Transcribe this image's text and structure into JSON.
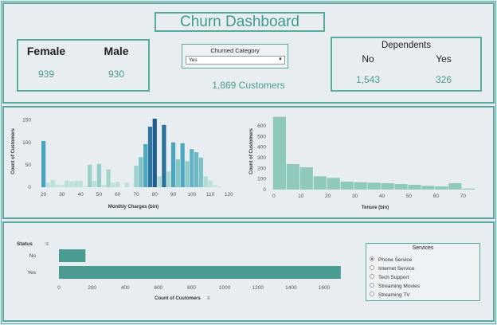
{
  "header": {
    "title": "Churn Dashboard"
  },
  "gender": {
    "female_label": "Female",
    "male_label": "Male",
    "female_value": "939",
    "male_value": "930"
  },
  "filter": {
    "title": "Churned Category",
    "selected": "Yes"
  },
  "customers_text": "1,869 Customers",
  "dependents": {
    "title": "Dependents",
    "no_label": "No",
    "yes_label": "Yes",
    "no_value": "1,543",
    "yes_value": "326"
  },
  "services": {
    "title": "Services",
    "items": [
      "Phone Service",
      "Internet Service",
      "Tech Support",
      "Streaming Movies",
      "Streaming TV"
    ],
    "selected": "Phone Service"
  },
  "chart_data": [
    {
      "type": "bar",
      "xlabel": "Monthly Charges (bin)",
      "ylabel": "Count of Customers",
      "xlim": [
        15,
        122
      ],
      "ylim": [
        0,
        160
      ],
      "xticks": [
        20,
        30,
        40,
        50,
        60,
        70,
        80,
        90,
        100,
        110,
        120
      ],
      "yticks": [
        0,
        50,
        100,
        150
      ],
      "bin_width": 2.5,
      "x": [
        20,
        22.5,
        25,
        27.5,
        30,
        32.5,
        35,
        37.5,
        40,
        42.5,
        45,
        47.5,
        50,
        52.5,
        55,
        57.5,
        60,
        62.5,
        65,
        67.5,
        70,
        72.5,
        75,
        77.5,
        80,
        82.5,
        85,
        87.5,
        90,
        92.5,
        95,
        97.5,
        100,
        102.5,
        105,
        107.5,
        110,
        112.5,
        115,
        117.5
      ],
      "values": [
        103,
        10,
        16,
        6,
        5,
        15,
        13,
        14,
        14,
        2,
        50,
        14,
        52,
        5,
        40,
        10,
        12,
        0,
        10,
        0,
        48,
        67,
        96,
        135,
        153,
        24,
        139,
        35,
        100,
        62,
        98,
        58,
        85,
        78,
        66,
        24,
        15,
        5,
        2,
        0
      ]
    },
    {
      "type": "bar",
      "xlabel": "Tenure (bin)",
      "ylabel": "Count of Customers",
      "xlim": [
        -2,
        77
      ],
      "ylim": [
        0,
        720
      ],
      "xticks": [
        0,
        10,
        20,
        30,
        40,
        50,
        60,
        70
      ],
      "yticks": [
        0,
        100,
        200,
        300,
        400,
        500,
        600
      ],
      "bin_width": 5,
      "x": [
        0,
        5,
        10,
        15,
        20,
        25,
        30,
        35,
        40,
        45,
        50,
        55,
        60,
        65,
        70
      ],
      "values": [
        685,
        240,
        210,
        125,
        110,
        75,
        70,
        65,
        60,
        52,
        45,
        35,
        30,
        60,
        10
      ]
    },
    {
      "type": "bar",
      "orientation": "horizontal",
      "ylabel": "Status",
      "xlabel": "Count of Customers",
      "categories": [
        "No",
        "Yes"
      ],
      "values": [
        160,
        1700
      ],
      "xlim": [
        0,
        1720
      ],
      "xticks": [
        0,
        200,
        400,
        600,
        800,
        1000,
        1200,
        1400,
        1600
      ]
    }
  ],
  "colors": {
    "accent": "#5aa9a0",
    "bar_teal": "#4a9c92",
    "tenure_bar": "#8fc9be"
  }
}
